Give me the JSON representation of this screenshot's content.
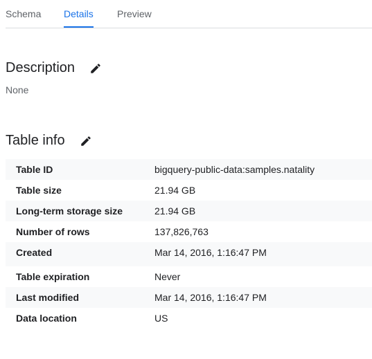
{
  "tabs": [
    {
      "label": "Schema"
    },
    {
      "label": "Details",
      "active": true
    },
    {
      "label": "Preview"
    }
  ],
  "description": {
    "title": "Description",
    "value": "None",
    "icon": "edit-icon"
  },
  "table_info": {
    "title": "Table info",
    "icon": "edit-icon",
    "rows": [
      {
        "label": "Table ID",
        "value": "bigquery-public-data:samples.natality"
      },
      {
        "label": "Table size",
        "value": "21.94 GB"
      },
      {
        "label": "Long-term storage size",
        "value": "21.94 GB"
      },
      {
        "label": "Number of rows",
        "value": "137,826,763"
      },
      {
        "label": "Created",
        "value": "Mar 14, 2016, 1:16:47 PM"
      },
      {
        "label": "Table expiration",
        "value": "Never"
      },
      {
        "label": "Last modified",
        "value": "Mar 14, 2016, 1:16:47 PM"
      },
      {
        "label": "Data location",
        "value": "US"
      }
    ]
  },
  "colors": {
    "accent": "#1a73e8",
    "text": "#202124",
    "muted": "#5f6368",
    "row_shade": "#f8f9fa"
  }
}
